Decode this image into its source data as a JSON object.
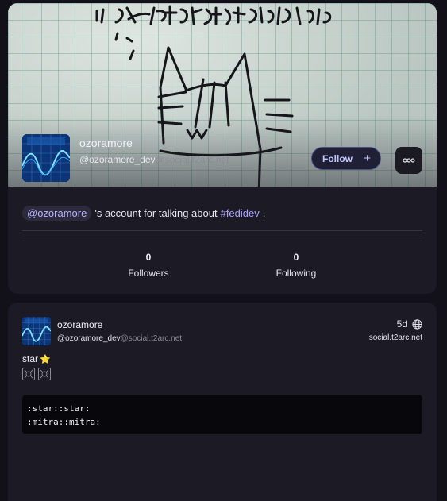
{
  "profile": {
    "display_name": "ozoramore",
    "handle_user": "@ozoramore_dev",
    "handle_host": "@social.t2arc.net",
    "follow_label": "Follow",
    "follow_icon": "plus-icon",
    "more_icon": "more-horizontal-icon",
    "bio": {
      "mention": "@ozoramore",
      "middle": "'s account for talking about",
      "hashtag": "#fedidev",
      "end": "."
    },
    "stats": [
      {
        "value": "0",
        "label": "Followers"
      },
      {
        "value": "0",
        "label": "Following"
      }
    ]
  },
  "post": {
    "display_name": "ozoramore",
    "handle_user": "@ozoramore_dev",
    "handle_host": "@social.t2arc.net",
    "time": "5d",
    "visibility_icon": "globe-icon",
    "instance": "social.t2arc.net",
    "text": "star",
    "star_emoji": "⭐",
    "code_lines": [
      ":star::star:",
      ":mitra::mitra:"
    ]
  },
  "colors": {
    "background": "#121018",
    "card": "#1c1a24",
    "accent": "#a9a4ff",
    "follow_border": "#4b4f88"
  }
}
